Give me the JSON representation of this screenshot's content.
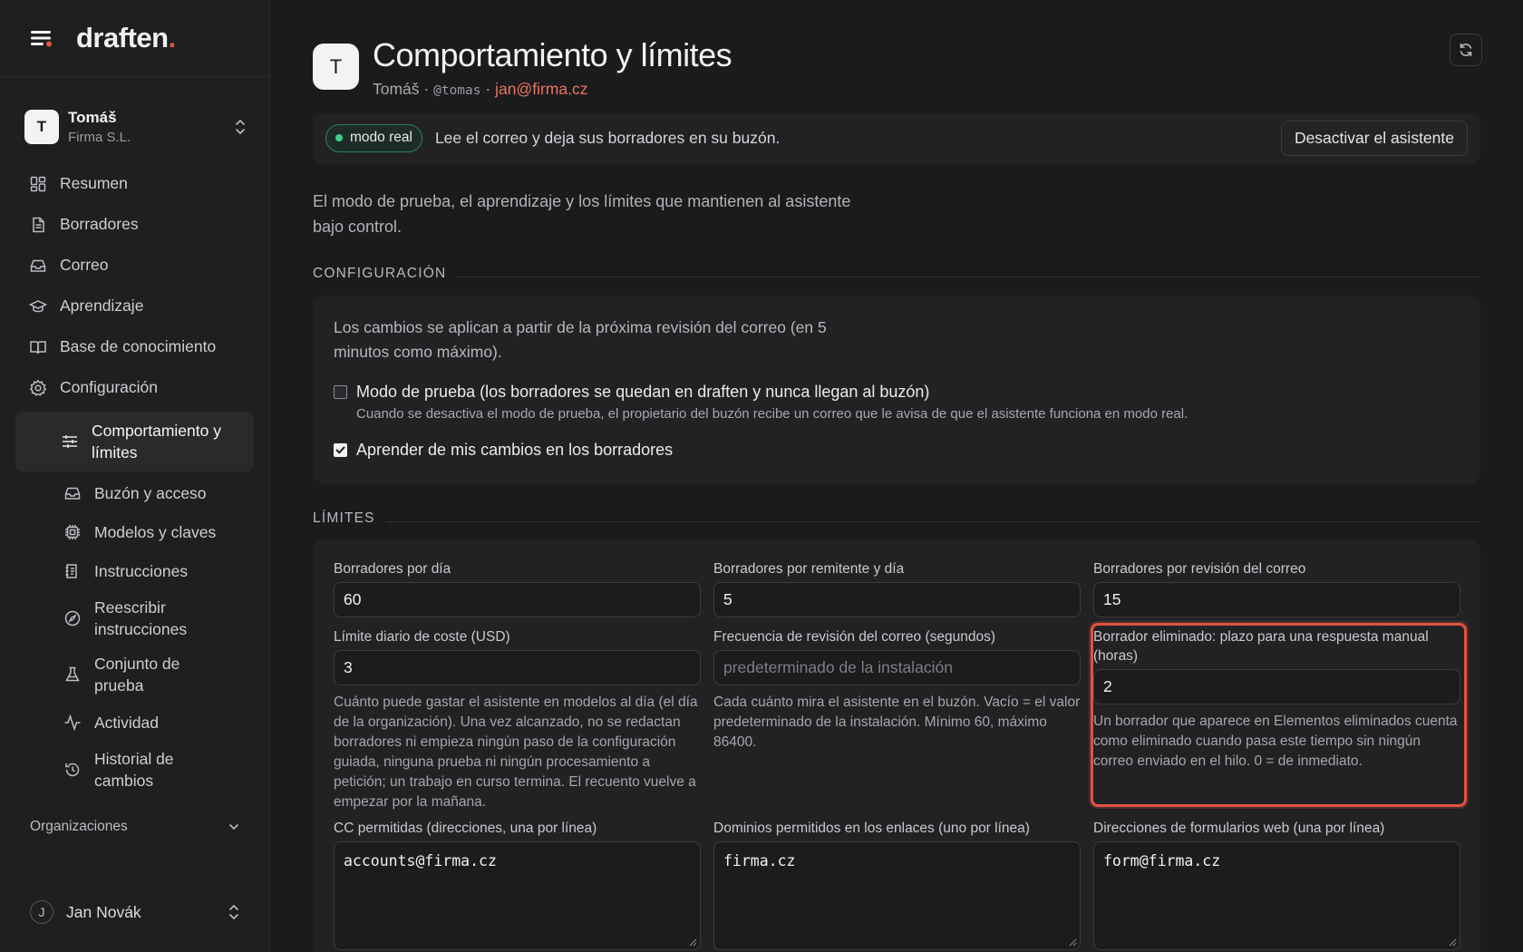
{
  "brand": {
    "name": "draften",
    "dot": "."
  },
  "account": {
    "initial": "T",
    "name": "Tomáš",
    "org": "Firma S.L."
  },
  "nav": {
    "items": [
      {
        "label": "Resumen",
        "icon": "dashboard-icon"
      },
      {
        "label": "Borradores",
        "icon": "document-icon"
      },
      {
        "label": "Correo",
        "icon": "inbox-icon"
      },
      {
        "label": "Aprendizaje",
        "icon": "graduation-cap-icon"
      },
      {
        "label": "Base de conocimiento",
        "icon": "book-icon"
      },
      {
        "label": "Configuración",
        "icon": "gear-icon"
      }
    ],
    "sub": [
      {
        "label": "Comportamiento y límites",
        "icon": "sliders-icon"
      },
      {
        "label": "Buzón y acceso",
        "icon": "inbox-icon"
      },
      {
        "label": "Modelos y claves",
        "icon": "chip-icon"
      },
      {
        "label": "Instrucciones",
        "icon": "instructions-icon"
      },
      {
        "label": "Reescribir instrucciones",
        "icon": "compass-icon"
      },
      {
        "label": "Conjunto de prueba",
        "icon": "flask-icon"
      },
      {
        "label": "Actividad",
        "icon": "activity-icon"
      },
      {
        "label": "Historial de cambios",
        "icon": "history-icon"
      }
    ],
    "orgs_label": "Organizaciones"
  },
  "user": {
    "initial": "J",
    "name": "Jan Novák"
  },
  "page": {
    "avatar": "T",
    "title": "Comportamiento y límites",
    "meta_name": "Tomáš ·",
    "meta_handle": "@tomas",
    "meta_sep": "·",
    "meta_email": "jan@firma.cz"
  },
  "banner": {
    "badge": "modo real",
    "text": "Lee el correo y deja sus borradores en su buzón.",
    "button": "Desactivar el asistente"
  },
  "intro": "El modo de prueba, el aprendizaje y los límites que mantienen al asistente bajo control.",
  "config": {
    "title": "CONFIGURACIÓN",
    "note": "Los cambios se aplican a partir de la próxima revisión del correo (en 5 minutos como máximo).",
    "test_mode_label": "Modo de prueba (los borradores se quedan en draften y nunca llegan al buzón)",
    "test_mode_checked": false,
    "test_mode_hint": "Cuando se desactiva el modo de prueba, el propietario del buzón recibe un correo que le avisa de que el asistente funciona en modo real.",
    "learn_label": "Aprender de mis cambios en los borradores",
    "learn_checked": true
  },
  "limits": {
    "title": "LÍMITES",
    "drafts_per_day": {
      "label": "Borradores por día",
      "value": "60"
    },
    "drafts_per_sender": {
      "label": "Borradores por remitente y día",
      "value": "5"
    },
    "drafts_per_check": {
      "label": "Borradores por revisión del correo",
      "value": "15"
    },
    "cost_limit": {
      "label": "Límite diario de coste (USD)",
      "value": "3",
      "help": "Cuánto puede gastar el asistente en modelos al día (el día de la organización). Una vez alcanzado, no se redactan borradores ni empieza ningún paso de la configuración guiada, ninguna prueba ni ningún procesamiento a petición; un trabajo en curso termina. El recuento vuelve a empezar por la mañana."
    },
    "poll_frequency": {
      "label": "Frecuencia de revisión del correo (segundos)",
      "placeholder": "predeterminado de la instalación",
      "help": "Cada cuánto mira el asistente en el buzón. Vacío = el valor predeterminado de la instalación. Mínimo 60, máximo 86400."
    },
    "deleted_draft": {
      "label": "Borrador eliminado: plazo para una respuesta manual (horas)",
      "value": "2",
      "help": "Un borrador que aparece en Elementos eliminados cuenta como eliminado cuando pasa este tiempo sin ningún correo enviado en el hilo. 0 = de inmediato."
    },
    "cc_allowed": {
      "label": "CC permitidas (direcciones, una por línea)",
      "value": "accounts@firma.cz"
    },
    "domains_allowed": {
      "label": "Dominios permitidos en los enlaces (uno por línea)",
      "value": "firma.cz"
    },
    "webform_addresses": {
      "label": "Direcciones de formularios web (una por línea)",
      "value": "form@firma.cz"
    }
  },
  "colors": {
    "accent": "#e8533f",
    "email": "#e8735f",
    "live_dot": "#3fcf8e",
    "background": "#1b1b1d"
  }
}
